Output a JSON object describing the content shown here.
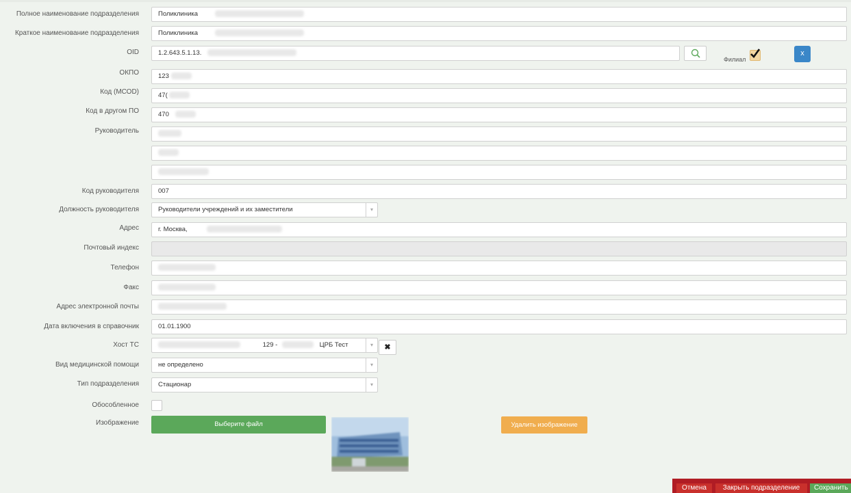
{
  "form": {
    "full_name": {
      "label": "Полное наименование подразделения",
      "value": "Поликлиника"
    },
    "short_name": {
      "label": "Краткое наименование подразделения",
      "value": "Поликлиника"
    },
    "oid": {
      "label": "OID",
      "value": "1.2.643.5.1.13."
    },
    "branch": {
      "label": "Филиал",
      "checked": true,
      "clear_label": "x"
    },
    "okpo": {
      "label": "ОКПО",
      "value": "123"
    },
    "mcod": {
      "label": "Код (МСОD)",
      "value": "47("
    },
    "other_code": {
      "label": "Код в другом ПО",
      "value": "470"
    },
    "head": {
      "label": "Руководитель"
    },
    "head_code": {
      "label": "Код руководителя",
      "value": "007"
    },
    "head_position": {
      "label": "Должность руководителя",
      "value": "Руководители учреждений и их заместители"
    },
    "address": {
      "label": "Адрес",
      "value": "г. Москва,"
    },
    "postal_code": {
      "label": "Почтовый индекс",
      "value": ""
    },
    "phone": {
      "label": "Телефон"
    },
    "fax": {
      "label": "Факс"
    },
    "email": {
      "label": "Адрес электронной почты"
    },
    "date_added": {
      "label": "Дата включения в справочник",
      "value": "01.01.1900"
    },
    "host_tc": {
      "label": "Хост ТС",
      "value_num": "129 -",
      "value_name": "ЦРБ Тест",
      "clear_label": "✖"
    },
    "care_type": {
      "label": "Вид медицинской помощи",
      "value": "не определено"
    },
    "unit_type": {
      "label": "Тип подразделения",
      "value": "Стационар"
    },
    "separate": {
      "label": "Обособленное",
      "checked": false
    },
    "image": {
      "label": "Изображение",
      "choose_label": "Выберите файл",
      "delete_label": "Удалить изображение"
    }
  },
  "footer": {
    "cancel_label": "Отмена",
    "close_label": "Закрыть подразделение",
    "save_label": "Сохранить"
  },
  "colors": {
    "green": "#5ba85a",
    "orange": "#f0ad4e",
    "blue": "#3a87c8",
    "red": "#c9302c"
  }
}
